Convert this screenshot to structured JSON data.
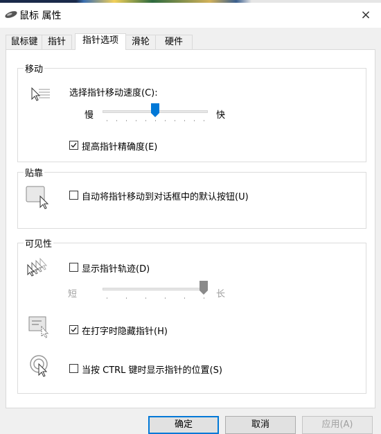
{
  "window": {
    "title": "鼠标 属性",
    "close_glyph": "×"
  },
  "tabs": [
    {
      "label": "鼠标键",
      "active": false
    },
    {
      "label": "指针",
      "active": false
    },
    {
      "label": "指针选项",
      "active": true
    },
    {
      "label": "滑轮",
      "active": false
    },
    {
      "label": "硬件",
      "active": false
    }
  ],
  "motion": {
    "group_label": "移动",
    "speed_label": "选择指针移动速度(C):",
    "slow_label": "慢",
    "fast_label": "快",
    "speed_value": 0.5,
    "enhance_precision": {
      "label": "提高指针精确度(E)",
      "checked": true
    }
  },
  "snap_to": {
    "group_label": "贴靠",
    "option": {
      "label": "自动将指针移动到对话框中的默认按钮(U)",
      "checked": false
    }
  },
  "visibility": {
    "group_label": "可见性",
    "trails": {
      "label": "显示指针轨迹(D)",
      "checked": false
    },
    "short_label": "短",
    "long_label": "长",
    "trail_length_value": 1.0,
    "hide_while_typing": {
      "label": "在打字时隐藏指针(H)",
      "checked": true
    },
    "show_location": {
      "label": "当按 CTRL 键时显示指针的位置(S)",
      "checked": false
    }
  },
  "buttons": {
    "ok": "确定",
    "cancel": "取消",
    "apply": "应用(A)"
  },
  "colors": {
    "accent": "#0078d7",
    "slider_disabled": "#8a8a8a"
  }
}
